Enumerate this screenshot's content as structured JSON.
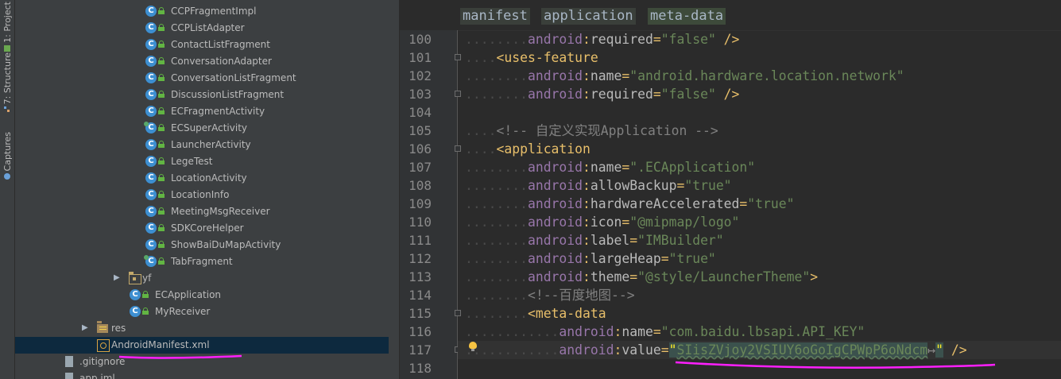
{
  "side_strip": {
    "tabs": [
      {
        "label": "1: Project",
        "icon": "project-icon"
      },
      {
        "label": "7: Structure",
        "icon": "structure-icon"
      },
      {
        "label": "Captures",
        "icon": "captures-icon"
      }
    ]
  },
  "project_tree": {
    "items": [
      {
        "label": "CCPFragmentImpl",
        "icon": "class-icon",
        "locked": true
      },
      {
        "label": "CCPListAdapter",
        "icon": "class-icon",
        "locked": true
      },
      {
        "label": "ContactListFragment",
        "icon": "class-icon",
        "locked": true
      },
      {
        "label": "ConversationAdapter",
        "icon": "class-icon",
        "locked": true
      },
      {
        "label": "ConversationListFragment",
        "icon": "class-icon",
        "locked": true
      },
      {
        "label": "DiscussionListFragment",
        "icon": "class-icon",
        "locked": true
      },
      {
        "label": "ECFragmentActivity",
        "icon": "class-icon",
        "locked": true
      },
      {
        "label": "ECSuperActivity",
        "icon": "abstract-class-icon",
        "locked": true
      },
      {
        "label": "LauncherActivity",
        "icon": "class-icon",
        "locked": true
      },
      {
        "label": "LegeTest",
        "icon": "class-icon",
        "locked": true
      },
      {
        "label": "LocationActivity",
        "icon": "class-icon",
        "locked": true
      },
      {
        "label": "LocationInfo",
        "icon": "class-icon",
        "locked": true
      },
      {
        "label": "MeetingMsgReceiver",
        "icon": "class-icon",
        "locked": true
      },
      {
        "label": "SDKCoreHelper",
        "icon": "class-icon",
        "locked": true
      },
      {
        "label": "ShowBaiDuMapActivity",
        "icon": "class-icon",
        "locked": true
      },
      {
        "label": "TabFragment",
        "icon": "abstract-class-icon",
        "locked": true
      },
      {
        "label": "yf",
        "icon": "package-icon",
        "expandable": true
      },
      {
        "label": "ECApplication",
        "icon": "class-icon",
        "locked": true
      },
      {
        "label": "MyReceiver",
        "icon": "class-icon",
        "locked": true
      },
      {
        "label": "res",
        "icon": "res-folder-icon",
        "expandable": true
      },
      {
        "label": "AndroidManifest.xml",
        "icon": "manifest-file-icon",
        "selected": true
      },
      {
        "label": ".gitignore",
        "icon": "text-file-icon"
      },
      {
        "label": "app.iml",
        "icon": "module-file-icon"
      }
    ]
  },
  "editor": {
    "breadcrumbs": [
      "manifest",
      "application",
      "meta-data"
    ],
    "lines": [
      {
        "n": "100",
        "indent": 2,
        "parts": [
          [
            "ns",
            "android"
          ],
          [
            "punct",
            ":"
          ],
          [
            "attr",
            "required"
          ],
          [
            "punct",
            "="
          ],
          [
            "val",
            "\"false\""
          ],
          [
            "punct",
            " />"
          ]
        ]
      },
      {
        "n": "101",
        "indent": 1,
        "parts": [
          [
            "tag",
            "<uses-feature"
          ]
        ]
      },
      {
        "n": "102",
        "indent": 2,
        "parts": [
          [
            "ns",
            "android"
          ],
          [
            "punct",
            ":"
          ],
          [
            "attr",
            "name"
          ],
          [
            "punct",
            "="
          ],
          [
            "val",
            "\"android.hardware.location.network\""
          ]
        ]
      },
      {
        "n": "103",
        "indent": 2,
        "parts": [
          [
            "ns",
            "android"
          ],
          [
            "punct",
            ":"
          ],
          [
            "attr",
            "required"
          ],
          [
            "punct",
            "="
          ],
          [
            "val",
            "\"false\""
          ],
          [
            "punct",
            " />"
          ]
        ]
      },
      {
        "n": "104",
        "indent": 0,
        "parts": []
      },
      {
        "n": "105",
        "indent": 1,
        "parts": [
          [
            "cmt",
            "<!-- 自定义实现Application -->"
          ]
        ]
      },
      {
        "n": "106",
        "indent": 1,
        "parts": [
          [
            "tag",
            "<application"
          ]
        ]
      },
      {
        "n": "107",
        "indent": 2,
        "parts": [
          [
            "ns",
            "android"
          ],
          [
            "punct",
            ":"
          ],
          [
            "attr",
            "name"
          ],
          [
            "punct",
            "="
          ],
          [
            "val",
            "\".ECApplication\""
          ]
        ]
      },
      {
        "n": "108",
        "indent": 2,
        "parts": [
          [
            "ns",
            "android"
          ],
          [
            "punct",
            ":"
          ],
          [
            "attr",
            "allowBackup"
          ],
          [
            "punct",
            "="
          ],
          [
            "val",
            "\"true\""
          ]
        ]
      },
      {
        "n": "109",
        "indent": 2,
        "parts": [
          [
            "ns",
            "android"
          ],
          [
            "punct",
            ":"
          ],
          [
            "attr",
            "hardwareAccelerated"
          ],
          [
            "punct",
            "="
          ],
          [
            "val",
            "\"true\""
          ]
        ]
      },
      {
        "n": "110",
        "indent": 2,
        "parts": [
          [
            "ns",
            "android"
          ],
          [
            "punct",
            ":"
          ],
          [
            "attr",
            "icon"
          ],
          [
            "punct",
            "="
          ],
          [
            "val",
            "\"@mipmap/logo\""
          ]
        ]
      },
      {
        "n": "111",
        "indent": 2,
        "parts": [
          [
            "ns",
            "android"
          ],
          [
            "punct",
            ":"
          ],
          [
            "attr",
            "label"
          ],
          [
            "punct",
            "="
          ],
          [
            "val",
            "\"IMBuilder\""
          ]
        ]
      },
      {
        "n": "112",
        "indent": 2,
        "parts": [
          [
            "ns",
            "android"
          ],
          [
            "punct",
            ":"
          ],
          [
            "attr",
            "largeHeap"
          ],
          [
            "punct",
            "="
          ],
          [
            "val",
            "\"true\""
          ]
        ]
      },
      {
        "n": "113",
        "indent": 2,
        "parts": [
          [
            "ns",
            "android"
          ],
          [
            "punct",
            ":"
          ],
          [
            "attr",
            "theme"
          ],
          [
            "punct",
            "="
          ],
          [
            "val",
            "\"@style/LauncherTheme\""
          ],
          [
            "punct",
            ">"
          ]
        ]
      },
      {
        "n": "114",
        "indent": 2,
        "parts": [
          [
            "cmt",
            "<!--百度地图-->"
          ]
        ]
      },
      {
        "n": "115",
        "indent": 2,
        "parts": [
          [
            "tag",
            "<meta-data"
          ]
        ]
      },
      {
        "n": "116",
        "indent": 3,
        "parts": [
          [
            "ns",
            "android"
          ],
          [
            "punct",
            ":"
          ],
          [
            "attr",
            "name"
          ],
          [
            "punct",
            "="
          ],
          [
            "val",
            "\"com.baidu.lbsapi.API_KEY\""
          ]
        ]
      },
      {
        "n": "117",
        "indent": 3,
        "parts": [
          [
            "ns",
            "android"
          ],
          [
            "punct",
            ":"
          ],
          [
            "attr",
            "value"
          ],
          [
            "punct",
            "="
          ],
          [
            "qhl",
            "\""
          ],
          [
            "valspell",
            "SIisZVjoy2VSIUY6oGoIgCPWpP6oNdcm"
          ],
          [
            "folded",
            "↦"
          ],
          [
            "qhl",
            "\""
          ],
          [
            "punct",
            " />"
          ]
        ]
      },
      {
        "n": "118",
        "indent": 0,
        "parts": []
      }
    ]
  }
}
